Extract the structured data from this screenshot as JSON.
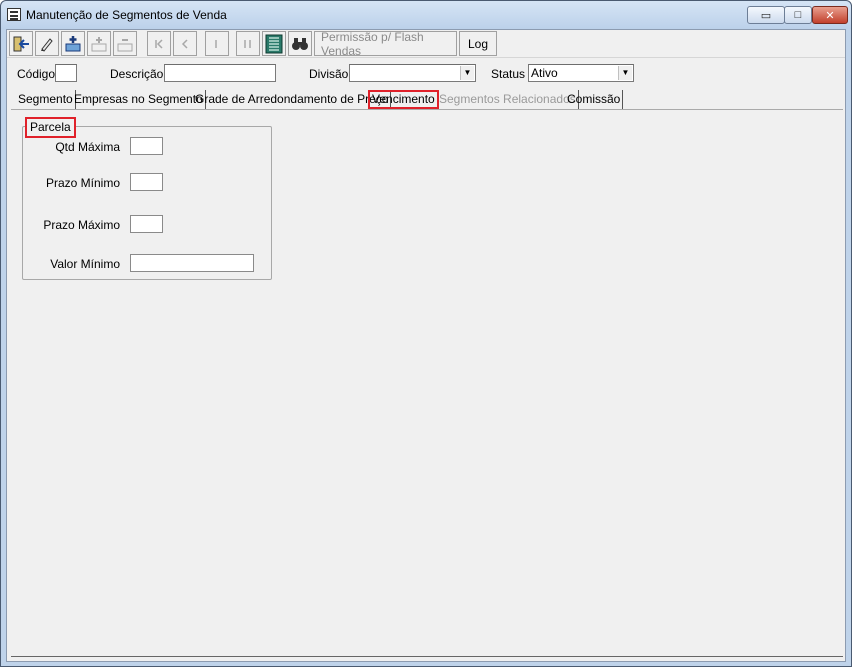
{
  "window": {
    "title": "Manutenção de Segmentos de Venda"
  },
  "titlebar_buttons": {
    "minimize": "▭",
    "maximize": "□",
    "close": "✕"
  },
  "toolbar": {
    "icons": [
      "exit-icon",
      "edit-icon",
      "add-icon",
      "add-disabled-icon",
      "remove-disabled-icon",
      "first-icon",
      "prev-icon",
      "next-icon",
      "last-icon",
      "list-icon",
      "binoculars-icon"
    ],
    "permission_label": "Permissão p/ Flash Vendas",
    "log_label": "Log"
  },
  "filters": {
    "codigo_label": "Código",
    "codigo_value": "",
    "descricao_label": "Descrição",
    "descricao_value": "",
    "divisao_label": "Divisão",
    "divisao_value": "",
    "status_label": "Status",
    "status_value": "Ativo"
  },
  "tabs": [
    {
      "label": "Segmento"
    },
    {
      "label": "Empresas no Segmento"
    },
    {
      "label": "Grade de Arredondamento de Preço"
    },
    {
      "label": "Vencimento"
    },
    {
      "label": "Segmentos Relacionados"
    },
    {
      "label": "Comissão"
    }
  ],
  "selected_tab": "Vencimento",
  "parcela": {
    "title": "Parcela",
    "fields": [
      {
        "label": "Qtd Máxima",
        "value": ""
      },
      {
        "label": "Prazo Mínimo",
        "value": ""
      },
      {
        "label": "Prazo Máximo",
        "value": ""
      },
      {
        "label": "Valor Mínimo",
        "value": ""
      }
    ]
  },
  "colors": {
    "highlight": "#e0212a",
    "background": "#f0f0f0"
  }
}
